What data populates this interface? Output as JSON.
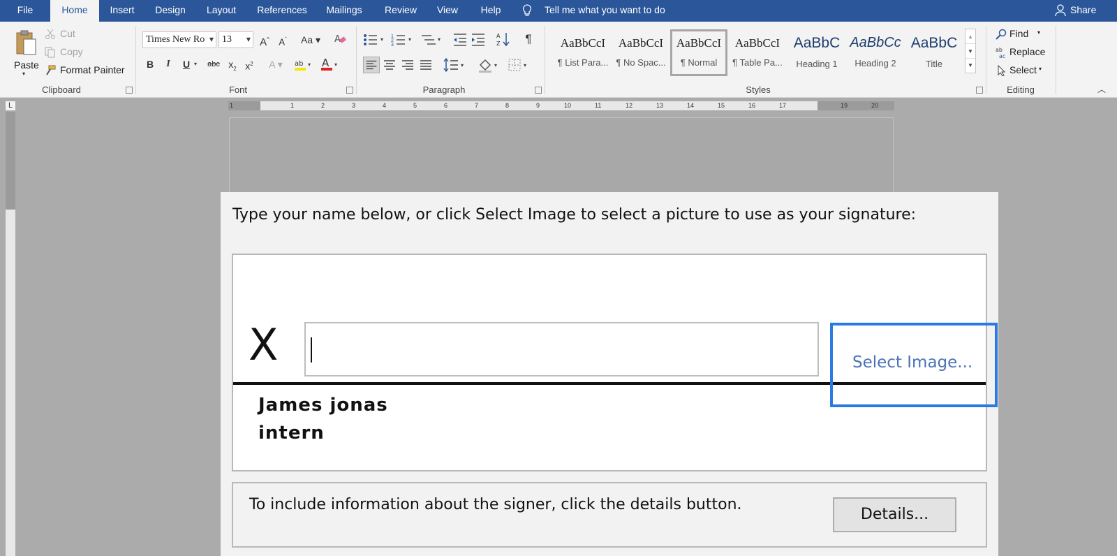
{
  "tabs": [
    "File",
    "Home",
    "Insert",
    "Design",
    "Layout",
    "References",
    "Mailings",
    "Review",
    "View",
    "Help"
  ],
  "active_tab": "Home",
  "tell_me": "Tell me what you want to do",
  "share": "Share",
  "clipboard": {
    "paste": "Paste",
    "cut": "Cut",
    "copy": "Copy",
    "format_painter": "Format Painter",
    "label": "Clipboard"
  },
  "font": {
    "family": "Times New Ro",
    "size": "13",
    "label": "Font"
  },
  "paragraph": {
    "label": "Paragraph"
  },
  "styles": {
    "label": "Styles",
    "items": [
      {
        "sample": "AaBbCcI",
        "name": "¶ List Para..."
      },
      {
        "sample": "AaBbCcI",
        "name": "¶ No Spac..."
      },
      {
        "sample": "AaBbCcI",
        "name": "¶ Normal"
      },
      {
        "sample": "AaBbCcI",
        "name": "¶ Table Pa..."
      },
      {
        "sample": "AaBbC",
        "name": "Heading 1"
      },
      {
        "sample": "AaBbCc",
        "name": "Heading 2"
      },
      {
        "sample": "AaBbC",
        "name": "Title"
      }
    ]
  },
  "editing": {
    "find": "Find",
    "replace": "Replace",
    "select": "Select",
    "label": "Editing"
  },
  "ruler_ticks": [
    "1",
    "1",
    "2",
    "3",
    "4",
    "5",
    "6",
    "7",
    "8",
    "9",
    "10",
    "11",
    "12",
    "13",
    "14",
    "15",
    "16",
    "17",
    "19",
    "20"
  ],
  "dialog": {
    "instructions": "Type your name below, or click Select Image to select a picture to use as your signature:",
    "x_mark": "X",
    "name_input_value": "",
    "select_image": "Select Image...",
    "signer_name": "James jonas",
    "signer_title": "intern",
    "info_text": "To include information about the signer, click the details button.",
    "details_button": "Details..."
  },
  "colors": {
    "tab_bar": "#2b579a",
    "ribbon": "#f3f3f3",
    "focus_border": "#2a7ae2",
    "link_text": "#4a72b8"
  }
}
